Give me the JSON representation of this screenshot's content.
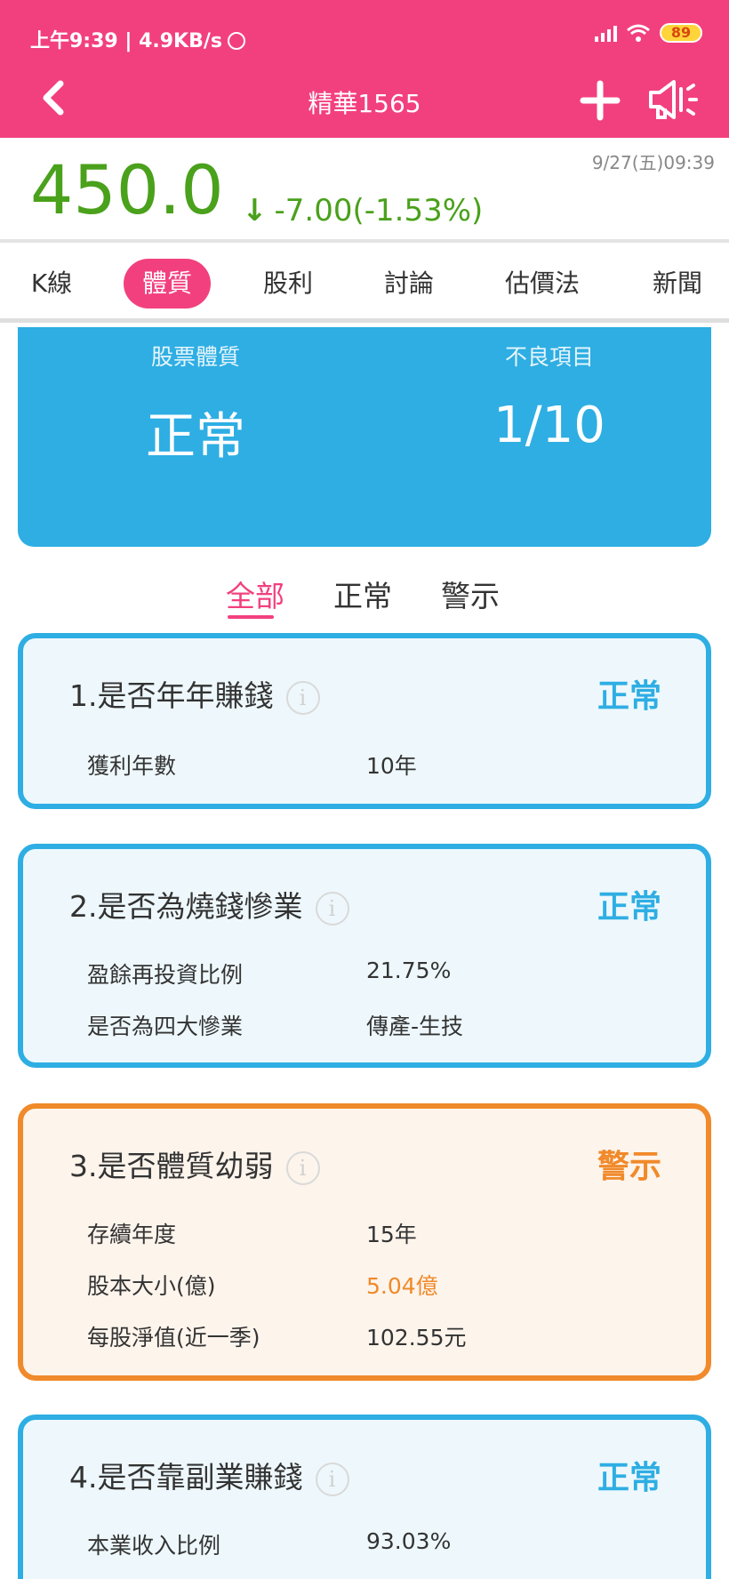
{
  "status_bar": {
    "time_speed": "上午9:39 | 4.9KB/s",
    "battery": "89"
  },
  "header": {
    "title": "精華1565"
  },
  "quote": {
    "price": "450.0",
    "arrow": "↓",
    "change": "-7.00(-1.53%)",
    "datetime": "9/27(五)09:39"
  },
  "tabs": [
    "K線",
    "體質",
    "股利",
    "討論",
    "估價法",
    "新聞"
  ],
  "summary": {
    "health_label": "股票體質",
    "health_value": "正常",
    "bad_label": "不良項目",
    "bad_value": "1/10"
  },
  "filter": {
    "all": "全部",
    "normal": "正常",
    "warning": "警示"
  },
  "cards": [
    {
      "title": "1.是否年年賺錢",
      "status": "正常",
      "rows": [
        {
          "k": "獲利年數",
          "v": "10年"
        }
      ]
    },
    {
      "title": "2.是否為燒錢慘業",
      "status": "正常",
      "rows": [
        {
          "k": "盈餘再投資比例",
          "v": "21.75%"
        },
        {
          "k": "是否為四大慘業",
          "v": "傳產-生技"
        }
      ]
    },
    {
      "title": "3.是否體質幼弱",
      "status": "警示",
      "rows": [
        {
          "k": "存續年度",
          "v": "15年"
        },
        {
          "k": "股本大小(億)",
          "v": "5.04億"
        },
        {
          "k": "每股淨值(近一季)",
          "v": "102.55元"
        }
      ]
    },
    {
      "title": "4.是否靠副業賺錢",
      "status": "正常",
      "rows": [
        {
          "k": "本業收入比例",
          "v": "93.03%"
        }
      ]
    }
  ],
  "info_glyph": "i",
  "colors": {
    "brand": "#f2407e",
    "up_down_green": "#4aa11b",
    "normal_blue": "#2eaee3",
    "warning_orange": "#f08a2a"
  }
}
